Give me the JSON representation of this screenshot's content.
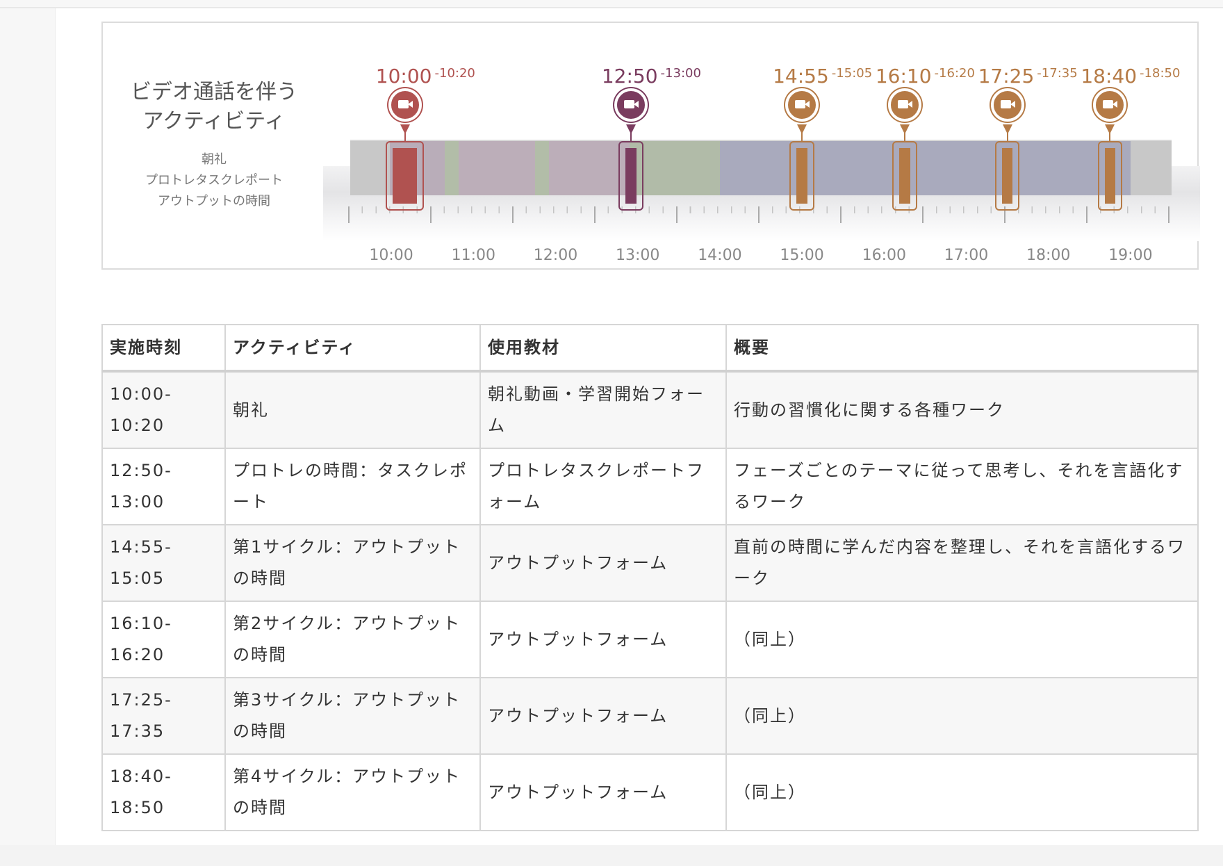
{
  "timeline": {
    "title_line1": "ビデオ通話を伴う",
    "title_line2": "アクティビティ",
    "legend_items": [
      "朝礼",
      "プロトレタスクレポート",
      "アウトプットの時間"
    ],
    "axis_start_hour": 9.5,
    "axis_end_hour": 19.5,
    "hour_labels": [
      "10:00",
      "11:00",
      "12:00",
      "13:00",
      "14:00",
      "15:00",
      "16:00",
      "17:00",
      "18:00",
      "19:00"
    ],
    "background_blocks": [
      {
        "from": 9.5,
        "to": 9.98,
        "color": "#c8c8c8"
      },
      {
        "from": 9.98,
        "to": 10.65,
        "color": "#b9adb9"
      },
      {
        "from": 10.65,
        "to": 10.82,
        "color": "#b2bda8"
      },
      {
        "from": 10.82,
        "to": 11.75,
        "color": "#bcaeb9"
      },
      {
        "from": 11.75,
        "to": 11.92,
        "color": "#b2bda8"
      },
      {
        "from": 11.92,
        "to": 12.9,
        "color": "#bcaeb9"
      },
      {
        "from": 12.9,
        "to": 14.0,
        "color": "#b1bba8"
      },
      {
        "from": 14.0,
        "to": 19.0,
        "color": "#a9aabd"
      },
      {
        "from": 19.0,
        "to": 19.5,
        "color": "#c8c8c8"
      }
    ],
    "slots": [
      {
        "start": "10:00",
        "end": "-10:20",
        "start_hour": 10.0,
        "end_hour": 10.3333,
        "color": "#b05250"
      },
      {
        "start": "12:50",
        "end": "-13:00",
        "start_hour": 12.8333,
        "end_hour": 13.0,
        "color": "#7a3c5f"
      },
      {
        "start": "14:55",
        "end": "-15:05",
        "start_hour": 14.9167,
        "end_hour": 15.0833,
        "color": "#b57a45"
      },
      {
        "start": "16:10",
        "end": "-16:20",
        "start_hour": 16.1667,
        "end_hour": 16.3333,
        "color": "#b57a45"
      },
      {
        "start": "17:25",
        "end": "-17:35",
        "start_hour": 17.4167,
        "end_hour": 17.5833,
        "color": "#b57a45"
      },
      {
        "start": "18:40",
        "end": "-18:50",
        "start_hour": 18.6667,
        "end_hour": 18.8333,
        "color": "#b57a45"
      }
    ]
  },
  "table": {
    "headers": [
      "実施時刻",
      "アクティビティ",
      "使用教材",
      "概要"
    ],
    "rows": [
      {
        "time_line1": "10:00-",
        "time_line2": "10:20",
        "activity": "朝礼",
        "material": "朝礼動画・学習開始フォーム",
        "summary": "行動の習慣化に関する各種ワーク"
      },
      {
        "time_line1": "12:50-",
        "time_line2": "13:00",
        "activity": "プロトレの時間：タスクレポート",
        "material": "プロトレタスクレポートフォーム",
        "summary": "フェーズごとのテーマに従って思考し、それを言語化するワーク"
      },
      {
        "time_line1": "14:55-",
        "time_line2": "15:05",
        "activity": "第1サイクル：アウトプットの時間",
        "material": "アウトプットフォーム",
        "summary": "直前の時間に学んだ内容を整理し、それを言語化するワーク"
      },
      {
        "time_line1": "16:10-",
        "time_line2": "16:20",
        "activity": "第2サイクル：アウトプットの時間",
        "material": "アウトプットフォーム",
        "summary": "（同上）"
      },
      {
        "time_line1": "17:25-",
        "time_line2": "17:35",
        "activity": "第3サイクル：アウトプットの時間",
        "material": "アウトプットフォーム",
        "summary": "（同上）"
      },
      {
        "time_line1": "18:40-",
        "time_line2": "18:50",
        "activity": "第4サイクル：アウトプットの時間",
        "material": "アウトプットフォーム",
        "summary": "（同上）"
      }
    ]
  }
}
